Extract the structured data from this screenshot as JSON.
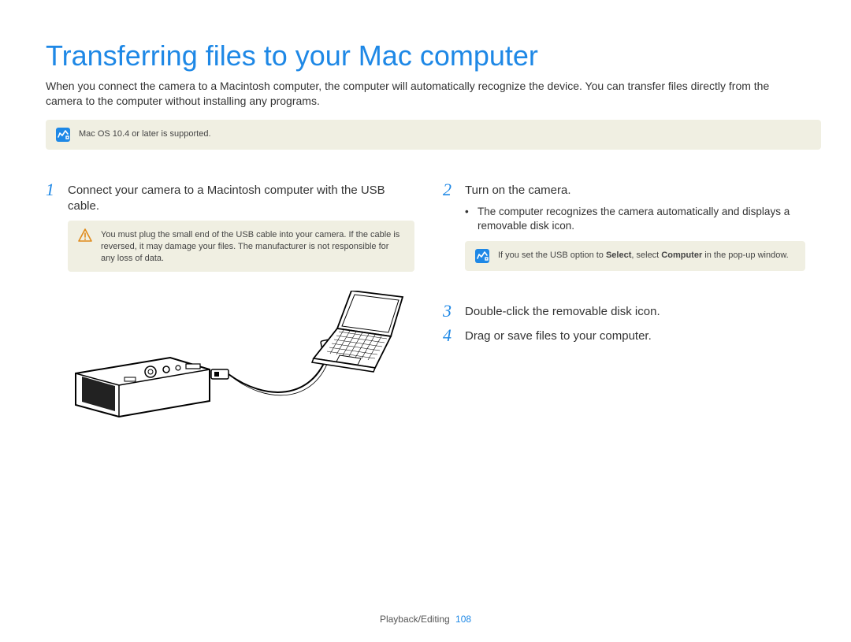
{
  "title": "Transferring files to your Mac computer",
  "intro": "When you connect the camera to a Macintosh computer, the computer will automatically recognize the device. You can transfer files directly from the camera to the computer without installing any programs.",
  "top_note": "Mac OS 10.4 or later is supported.",
  "left": {
    "step1_num": "1",
    "step1_text": "Connect your camera to a Macintosh computer with the USB cable.",
    "warn_text": "You must plug the small end of the USB cable into your camera. If the cable is reversed, it may damage your files. The manufacturer is not responsible for any loss of data."
  },
  "right": {
    "step2_num": "2",
    "step2_text": "Turn on the camera.",
    "bullet2": "The computer recognizes the camera automatically and displays a removable disk icon.",
    "note2_pre": "If you set the USB option to ",
    "note2_b1": "Select",
    "note2_mid": ", select ",
    "note2_b2": "Computer",
    "note2_post": " in the pop-up window.",
    "step3_num": "3",
    "step3_text": "Double-click the removable disk icon.",
    "step4_num": "4",
    "step4_text": "Drag or save files to your computer."
  },
  "footer": {
    "section": "Playback/Editing",
    "page": "108"
  }
}
